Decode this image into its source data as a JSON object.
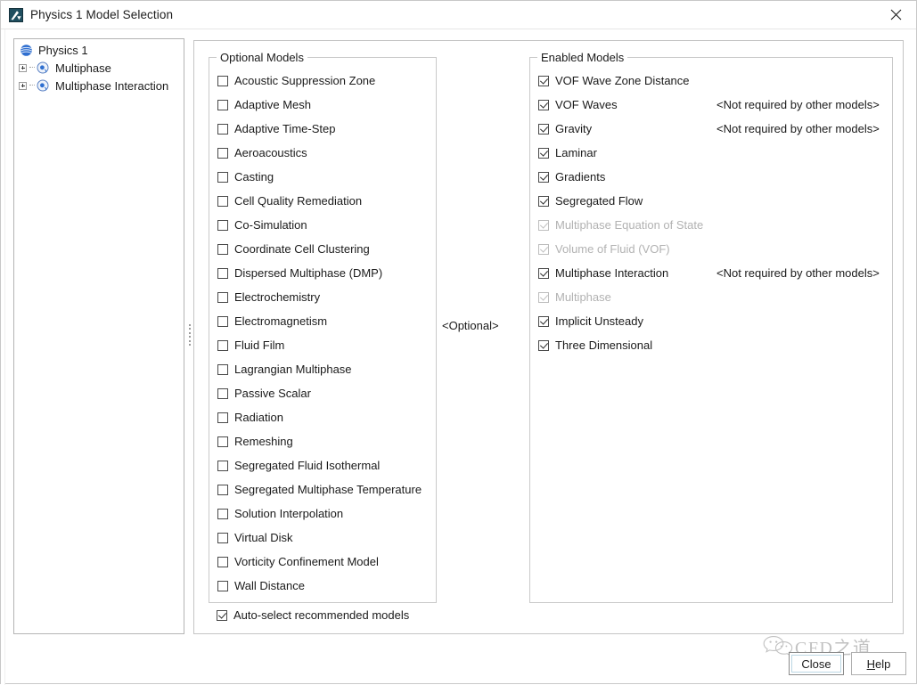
{
  "window": {
    "title": "Physics 1 Model Selection",
    "app_icon": "physics-model-icon",
    "close_icon": "close-icon"
  },
  "tree": {
    "nodes": [
      {
        "label": "Physics 1",
        "icon": "physics-sphere-icon",
        "expandable": false,
        "level": 0
      },
      {
        "label": "Multiphase",
        "icon": "model-node-icon",
        "expandable": true,
        "level": 1
      },
      {
        "label": "Multiphase Interaction",
        "icon": "model-node-icon",
        "expandable": true,
        "level": 1
      }
    ]
  },
  "optional_models": {
    "title": "Optional Models",
    "items": [
      {
        "label": "Acoustic Suppression Zone",
        "checked": false,
        "enabled": true
      },
      {
        "label": "Adaptive Mesh",
        "checked": false,
        "enabled": true
      },
      {
        "label": "Adaptive Time-Step",
        "checked": false,
        "enabled": true
      },
      {
        "label": "Aeroacoustics",
        "checked": false,
        "enabled": true
      },
      {
        "label": "Casting",
        "checked": false,
        "enabled": true
      },
      {
        "label": "Cell Quality Remediation",
        "checked": false,
        "enabled": true
      },
      {
        "label": "Co-Simulation",
        "checked": false,
        "enabled": true
      },
      {
        "label": "Coordinate Cell Clustering",
        "checked": false,
        "enabled": true
      },
      {
        "label": "Dispersed Multiphase (DMP)",
        "checked": false,
        "enabled": true
      },
      {
        "label": "Electrochemistry",
        "checked": false,
        "enabled": true
      },
      {
        "label": "Electromagnetism",
        "checked": false,
        "enabled": true
      },
      {
        "label": "Fluid Film",
        "checked": false,
        "enabled": true
      },
      {
        "label": "Lagrangian Multiphase",
        "checked": false,
        "enabled": true
      },
      {
        "label": "Passive Scalar",
        "checked": false,
        "enabled": true
      },
      {
        "label": "Radiation",
        "checked": false,
        "enabled": true
      },
      {
        "label": "Remeshing",
        "checked": false,
        "enabled": true
      },
      {
        "label": "Segregated Fluid Isothermal",
        "checked": false,
        "enabled": true
      },
      {
        "label": "Segregated Multiphase Temperature",
        "checked": false,
        "enabled": true
      },
      {
        "label": "Solution Interpolation",
        "checked": false,
        "enabled": true
      },
      {
        "label": "Virtual Disk",
        "checked": false,
        "enabled": true
      },
      {
        "label": "Vorticity Confinement Model",
        "checked": false,
        "enabled": true
      },
      {
        "label": "Wall Distance",
        "checked": false,
        "enabled": true
      }
    ]
  },
  "enabled_models": {
    "title": "Enabled Models",
    "items": [
      {
        "label": "VOF Wave Zone Distance",
        "checked": true,
        "enabled": true,
        "note": ""
      },
      {
        "label": "VOF Waves",
        "checked": true,
        "enabled": true,
        "note": "<Not required by other models>"
      },
      {
        "label": "Gravity",
        "checked": true,
        "enabled": true,
        "note": "<Not required by other models>"
      },
      {
        "label": "Laminar",
        "checked": true,
        "enabled": true,
        "note": ""
      },
      {
        "label": "Gradients",
        "checked": true,
        "enabled": true,
        "note": ""
      },
      {
        "label": "Segregated Flow",
        "checked": true,
        "enabled": true,
        "note": ""
      },
      {
        "label": "Multiphase Equation of State",
        "checked": true,
        "enabled": false,
        "note": ""
      },
      {
        "label": "Volume of Fluid (VOF)",
        "checked": true,
        "enabled": false,
        "note": ""
      },
      {
        "label": "Multiphase Interaction",
        "checked": true,
        "enabled": true,
        "note": "<Not required by other models>"
      },
      {
        "label": "Multiphase",
        "checked": true,
        "enabled": false,
        "note": ""
      },
      {
        "label": "Implicit Unsteady",
        "checked": true,
        "enabled": true,
        "note": ""
      },
      {
        "label": "Three Dimensional",
        "checked": true,
        "enabled": true,
        "note": ""
      }
    ]
  },
  "optional_marker": "<Optional>",
  "auto_select": {
    "label": "Auto-select recommended models",
    "checked": true
  },
  "buttons": {
    "close": "Close",
    "help_prefix": "H",
    "help_rest": "elp"
  },
  "watermark": {
    "text": "CFD之道",
    "icon": "wechat-icon"
  },
  "colors": {
    "accent": "#3366cc",
    "focus_ring": "#bcd7e4",
    "disabled_text": "#b2b2b2",
    "border": "#c9c9c9"
  }
}
